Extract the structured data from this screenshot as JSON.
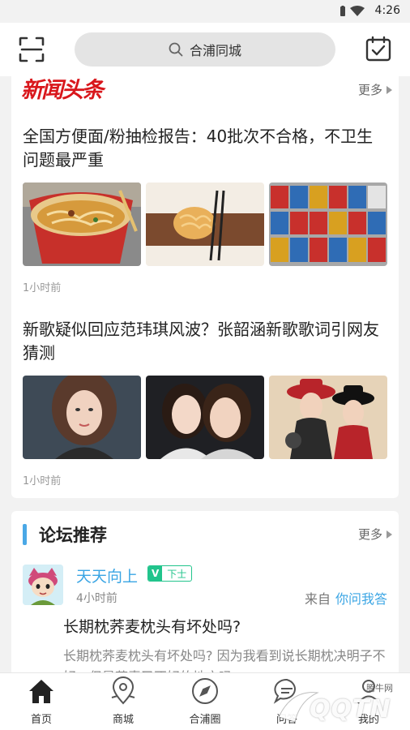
{
  "status_bar": {
    "time": "4:26"
  },
  "header": {
    "search_text": "合浦同城",
    "icons": [
      "scan-icon",
      "search-icon",
      "calendar-icon"
    ]
  },
  "news": {
    "logo_text": "新闻头条",
    "more_label": "更多",
    "articles": [
      {
        "title": "全国方便面/粉抽检报告：40批次不合格，不卫生问题最严重",
        "time": "1小时前",
        "thumbs": [
          "instant-noodle-cup-image",
          "noodles-with-chopsticks-image",
          "noodle-shelf-image"
        ]
      },
      {
        "title": "新歌疑似回应范玮琪风波？张韶涵新歌歌词引网友猜测",
        "time": "1小时前",
        "thumbs": [
          "singer-portrait-image",
          "two-singers-image",
          "singers-with-hats-image"
        ]
      }
    ]
  },
  "forum": {
    "title": "论坛推荐",
    "more_label": "更多",
    "post": {
      "username": "天天向上",
      "vip_label": "V",
      "level": "下士",
      "time": "4小时前",
      "from_prefix": "来自",
      "from_section": "你问我答",
      "title": "长期枕荞麦枕头有坏处吗?",
      "summary": "长期枕荞麦枕头有坏处吗? 因为我看到说长期枕决明子不好，但是荞麦又不好的地方吗"
    }
  },
  "tabs": [
    {
      "label": "首页",
      "icon": "home-icon",
      "active": true
    },
    {
      "label": "商城",
      "icon": "location-pin-icon",
      "active": false
    },
    {
      "label": "合浦圈",
      "icon": "compass-icon",
      "active": false
    },
    {
      "label": "问答",
      "icon": "chat-bubble-icon",
      "active": false
    },
    {
      "label": "我的",
      "icon": "profile-icon",
      "active": false
    }
  ],
  "watermark": {
    "text": "QQTN",
    "small": "腾牛网"
  },
  "colors": {
    "accent_blue": "#3aa5e4",
    "news_red": "#d9171c",
    "vip_green": "#22c48c",
    "background": "#f2f2f2"
  }
}
